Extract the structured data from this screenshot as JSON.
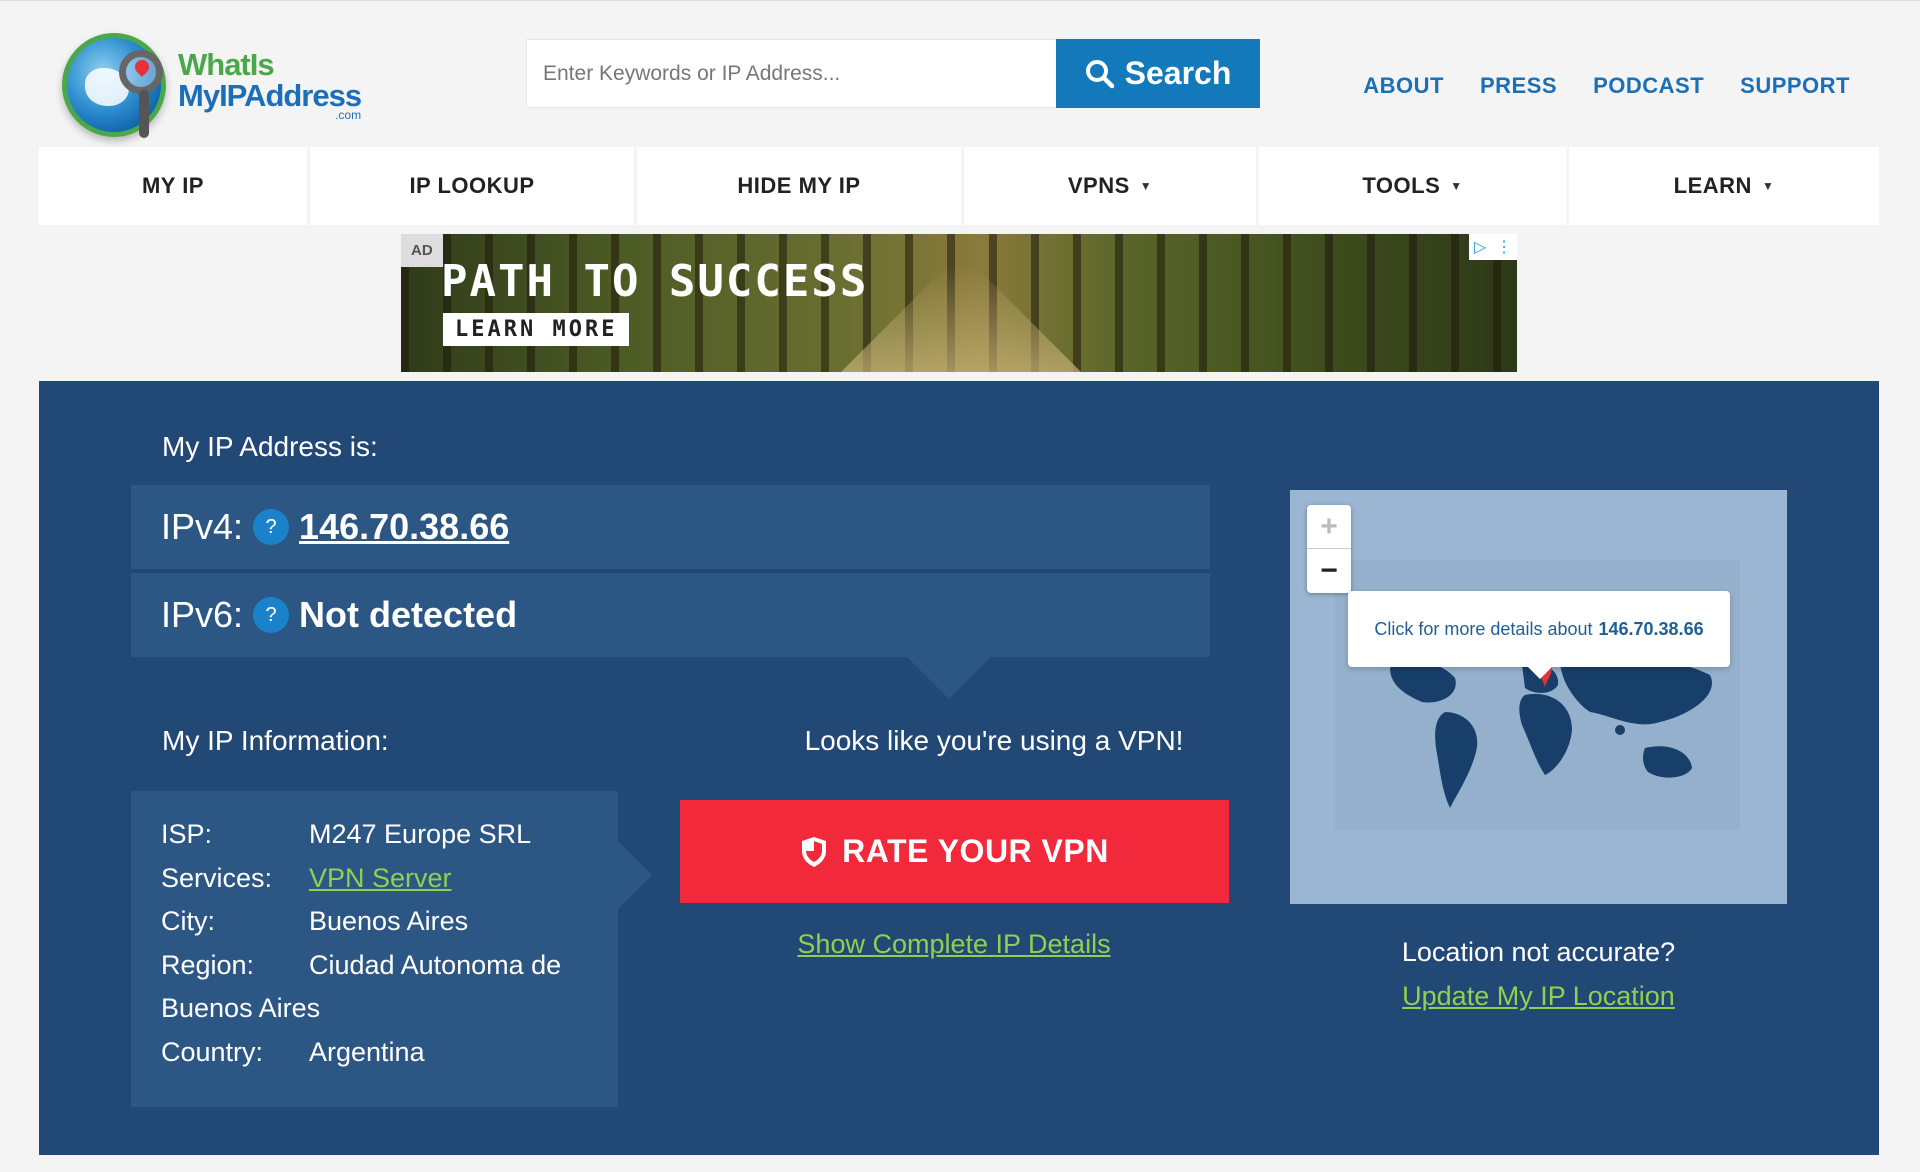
{
  "brand": {
    "line1": "WhatIs",
    "line2": "MyIPAddress",
    "line3": ".com"
  },
  "search": {
    "placeholder": "Enter Keywords or IP Address...",
    "button_label": "Search"
  },
  "top_links": [
    "ABOUT",
    "PRESS",
    "PODCAST",
    "SUPPORT"
  ],
  "nav": [
    {
      "label": "MY IP",
      "dropdown": false
    },
    {
      "label": "IP LOOKUP",
      "dropdown": false
    },
    {
      "label": "HIDE MY IP",
      "dropdown": false
    },
    {
      "label": "VPNS",
      "dropdown": true
    },
    {
      "label": "TOOLS",
      "dropdown": true
    },
    {
      "label": "LEARN",
      "dropdown": true
    }
  ],
  "ad": {
    "badge": "AD",
    "headline": "PATH TO SUCCESS",
    "cta": "LEARN MORE"
  },
  "main": {
    "my_ip_label": "My IP Address is:",
    "ipv4_label": "IPv4:",
    "ipv4_value": "146.70.38.66",
    "ipv6_label": "IPv6:",
    "ipv6_value": "Not detected",
    "help_glyph": "?",
    "info_label": "My IP Information:",
    "info": {
      "isp_key": "ISP:",
      "isp": "M247 Europe SRL",
      "services_key": "Services:",
      "services": "VPN Server",
      "city_key": "City:",
      "city": "Buenos Aires",
      "region_key": "Region:",
      "region": "Ciudad Autonoma de Buenos Aires",
      "country_key": "Country:",
      "country": "Argentina"
    },
    "vpn_message": "Looks like you're using a VPN!",
    "rate_button": "RATE YOUR VPN",
    "show_details": "Show Complete IP Details",
    "map_popup_text": "Click for more details about",
    "map_popup_ip": "146.70.38.66",
    "zoom_in": "+",
    "zoom_out": "−",
    "location_question": "Location not accurate?",
    "update_location": "Update My IP Location"
  },
  "colors": {
    "accent": "#1479ba",
    "panel": "#224875",
    "row": "#2c5684",
    "cta": "#f2283b",
    "link": "#8fd14f"
  }
}
